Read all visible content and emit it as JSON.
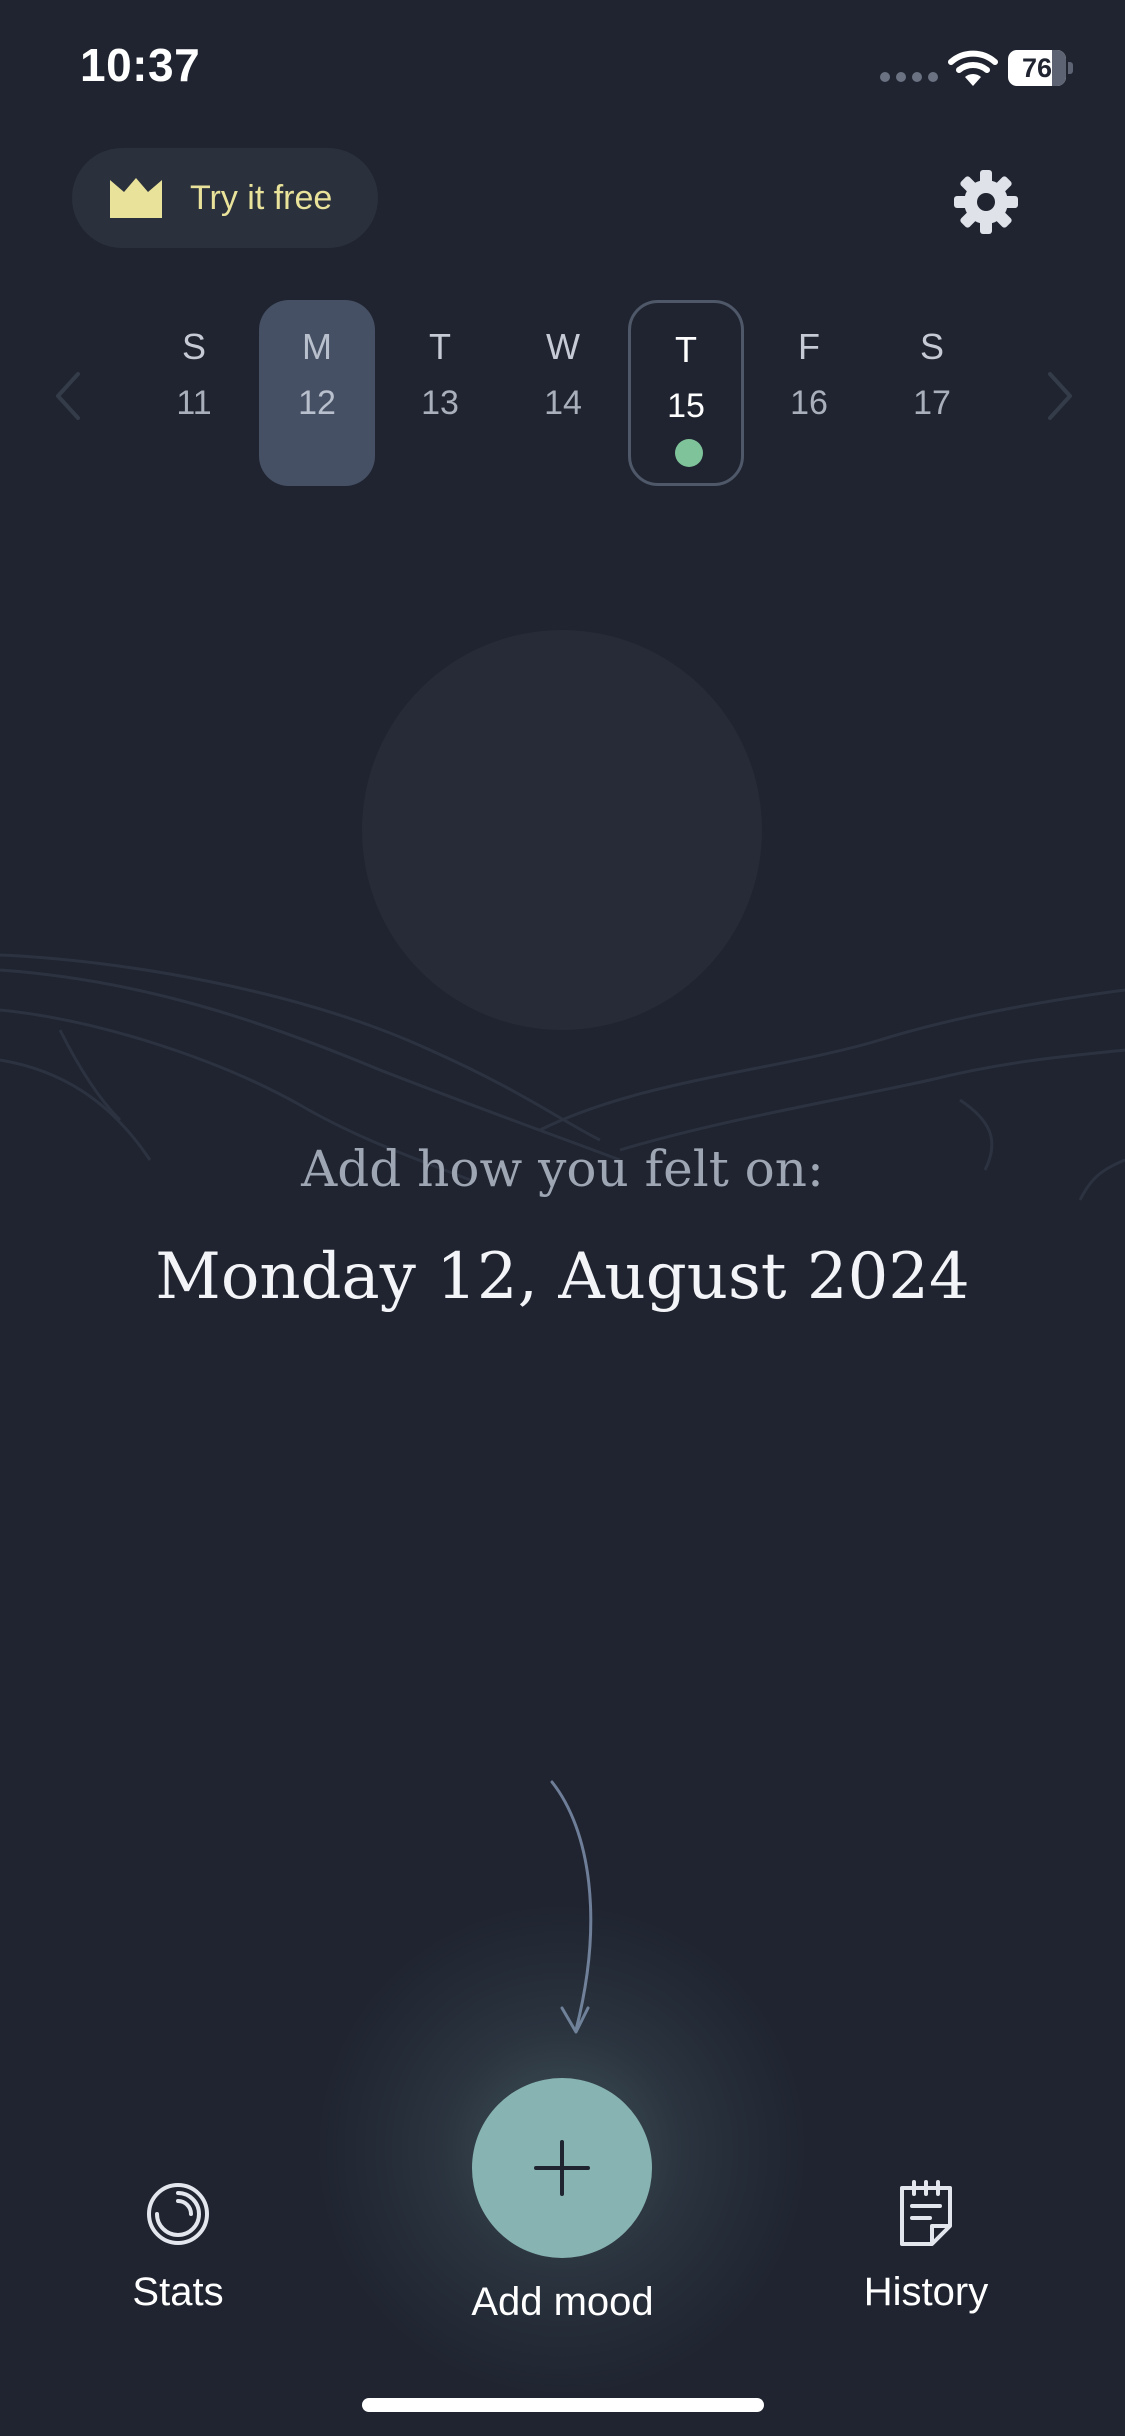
{
  "status_bar": {
    "time": "10:37",
    "battery_level": "76"
  },
  "header": {
    "try_free_label": "Try it free"
  },
  "week": {
    "days": [
      {
        "dow": "S",
        "num": "11"
      },
      {
        "dow": "M",
        "num": "12"
      },
      {
        "dow": "T",
        "num": "13"
      },
      {
        "dow": "W",
        "num": "14"
      },
      {
        "dow": "T",
        "num": "15"
      },
      {
        "dow": "F",
        "num": "16"
      },
      {
        "dow": "S",
        "num": "17"
      }
    ]
  },
  "main": {
    "prompt": "Add how you felt on:",
    "date": "Monday 12, August 2024"
  },
  "nav": {
    "stats_label": "Stats",
    "add_mood_label": "Add mood",
    "history_label": "History"
  },
  "colors": {
    "background": "#1f2430",
    "accent": "#87b4b3",
    "crown": "#e9e29a",
    "entry_dot": "#7fc39a",
    "selected_day": "#465064"
  },
  "icons": {
    "crown": "crown-icon",
    "settings": "gear-icon",
    "previous": "chevron-left-icon",
    "next": "chevron-right-icon",
    "add": "plus-icon",
    "stats": "stats-ring-icon",
    "history": "journal-icon"
  }
}
